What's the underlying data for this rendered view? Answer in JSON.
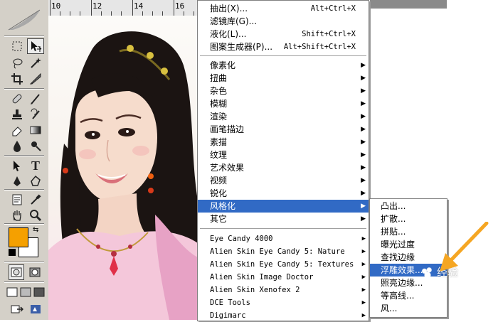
{
  "toolbox": {
    "tools": [
      "marquee-tool",
      "move-tool",
      "lasso-tool",
      "magic-wand-tool",
      "crop-tool",
      "slice-tool",
      "healing-brush-tool",
      "brush-tool",
      "clone-stamp-tool",
      "history-brush-tool",
      "eraser-tool",
      "gradient-tool",
      "blur-tool",
      "dodge-tool",
      "path-selection-tool",
      "type-tool",
      "pen-tool",
      "custom-shape-tool",
      "notes-tool",
      "eyedropper-tool",
      "hand-tool",
      "zoom-tool"
    ],
    "foreground_color": "#f5a000",
    "background_color": "#ffffff"
  },
  "ruler": {
    "ticks": [
      "10",
      "12",
      "14",
      "16"
    ]
  },
  "filter_menu": {
    "top_items": [
      {
        "label": "抽出(X)...",
        "shortcut": "Alt+Ctrl+X"
      },
      {
        "label": "滤镜库(G)..."
      },
      {
        "label": "液化(L)...",
        "shortcut": "Shift+Ctrl+X"
      },
      {
        "label": "图案生成器(P)...",
        "shortcut": "Alt+Shift+Ctrl+X"
      }
    ],
    "groups": [
      "像素化",
      "扭曲",
      "杂色",
      "模糊",
      "渲染",
      "画笔描边",
      "素描",
      "纹理",
      "艺术效果",
      "视频",
      "锐化",
      "风格化",
      "其它"
    ],
    "selected_group": "风格化",
    "plugins": [
      "Eye Candy 4000",
      "Alien Skin Eye Candy 5: Nature",
      "Alien Skin Eye Candy 5: Textures",
      "Alien Skin Image Doctor",
      "Alien Skin Xenofex 2",
      "DCE Tools",
      "Digimarc"
    ]
  },
  "stylize_submenu": {
    "items": [
      "凸出...",
      "扩散...",
      "拼贴...",
      "曝光过度",
      "查找边缘",
      "浮雕效果...",
      "照亮边缘...",
      "等高线...",
      "风..."
    ],
    "selected": "浮雕效果..."
  },
  "watermark": {
    "text": "经验"
  },
  "colors": {
    "menu_highlight": "#316ac5",
    "annotation_arrow": "#f5a623"
  }
}
